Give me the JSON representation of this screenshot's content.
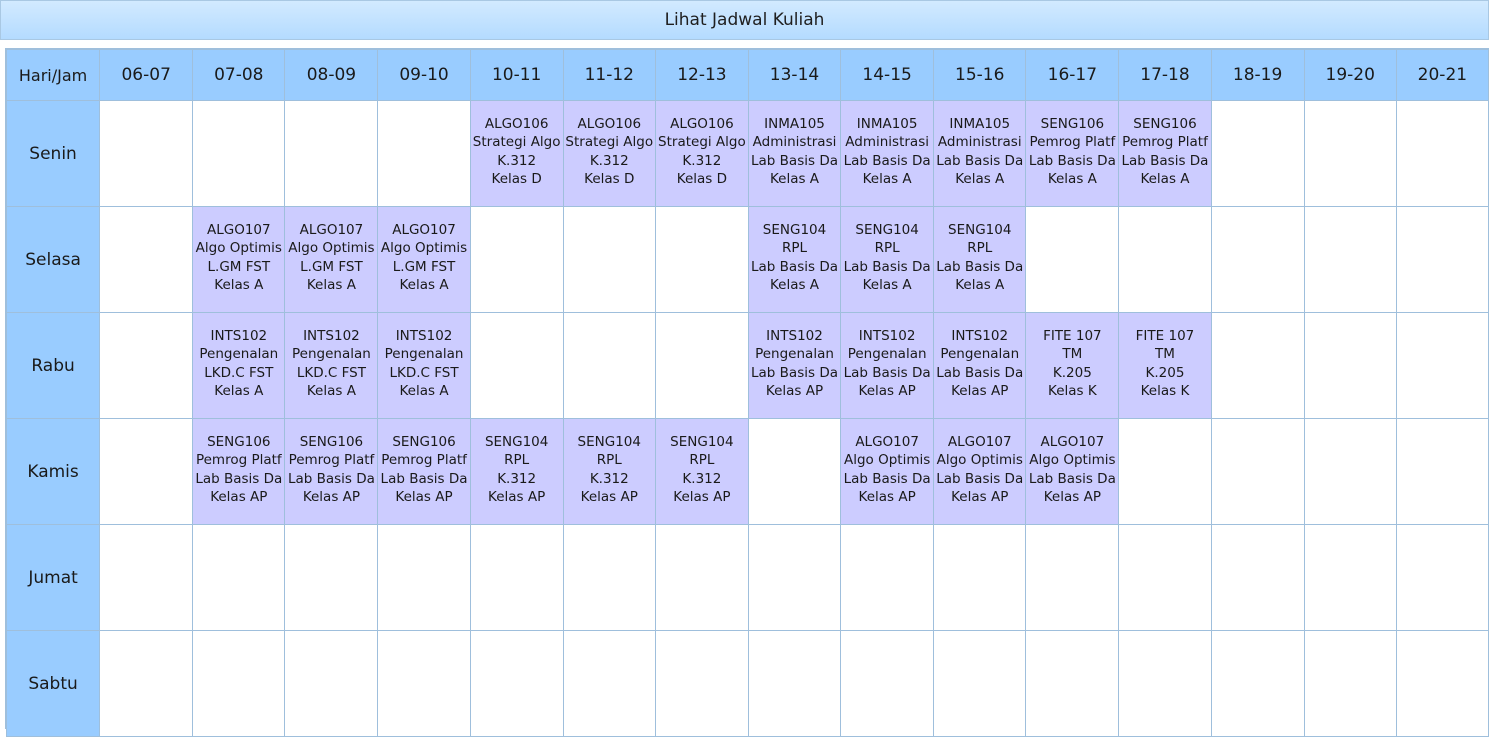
{
  "window": {
    "title": "Lihat Jadwal Kuliah"
  },
  "schedule": {
    "corner_label": "Hari/Jam",
    "hours": [
      "06-07",
      "07-08",
      "08-09",
      "09-10",
      "10-11",
      "11-12",
      "12-13",
      "13-14",
      "14-15",
      "15-16",
      "16-17",
      "17-18",
      "18-19",
      "19-20",
      "20-21"
    ],
    "days": [
      {
        "name": "Senin",
        "slots": [
          null,
          null,
          null,
          null,
          {
            "code": "ALGO106",
            "name": "Strategi Algo",
            "room": "K.312",
            "cls": "Kelas D"
          },
          {
            "code": "ALGO106",
            "name": "Strategi Algo",
            "room": "K.312",
            "cls": "Kelas D"
          },
          {
            "code": "ALGO106",
            "name": "Strategi Algo",
            "room": "K.312",
            "cls": "Kelas D"
          },
          {
            "code": "INMA105",
            "name": "Administrasi",
            "room": "Lab Basis Da",
            "cls": "Kelas A"
          },
          {
            "code": "INMA105",
            "name": "Administrasi",
            "room": "Lab Basis Da",
            "cls": "Kelas A"
          },
          {
            "code": "INMA105",
            "name": "Administrasi",
            "room": "Lab Basis Da",
            "cls": "Kelas A"
          },
          {
            "code": "SENG106",
            "name": "Pemrog Platf",
            "room": "Lab Basis Da",
            "cls": "Kelas A"
          },
          {
            "code": "SENG106",
            "name": "Pemrog Platf",
            "room": "Lab Basis Da",
            "cls": "Kelas A"
          },
          null,
          null,
          null
        ]
      },
      {
        "name": "Selasa",
        "slots": [
          null,
          {
            "code": "ALGO107",
            "name": "Algo Optimis",
            "room": "L.GM FST",
            "cls": "Kelas A"
          },
          {
            "code": "ALGO107",
            "name": "Algo Optimis",
            "room": "L.GM FST",
            "cls": "Kelas A"
          },
          {
            "code": "ALGO107",
            "name": "Algo Optimis",
            "room": "L.GM FST",
            "cls": "Kelas A"
          },
          null,
          null,
          null,
          {
            "code": "SENG104",
            "name": "RPL",
            "room": "Lab Basis Da",
            "cls": "Kelas A"
          },
          {
            "code": "SENG104",
            "name": "RPL",
            "room": "Lab Basis Da",
            "cls": "Kelas A"
          },
          {
            "code": "SENG104",
            "name": "RPL",
            "room": "Lab Basis Da",
            "cls": "Kelas A"
          },
          null,
          null,
          null,
          null,
          null
        ]
      },
      {
        "name": "Rabu",
        "slots": [
          null,
          {
            "code": "INTS102",
            "name": "Pengenalan",
            "room": "LKD.C FST",
            "cls": "Kelas A"
          },
          {
            "code": "INTS102",
            "name": "Pengenalan",
            "room": "LKD.C FST",
            "cls": "Kelas A"
          },
          {
            "code": "INTS102",
            "name": "Pengenalan",
            "room": "LKD.C FST",
            "cls": "Kelas A"
          },
          null,
          null,
          null,
          {
            "code": "INTS102",
            "name": "Pengenalan",
            "room": "Lab Basis Da",
            "cls": "Kelas AP"
          },
          {
            "code": "INTS102",
            "name": "Pengenalan",
            "room": "Lab Basis Da",
            "cls": "Kelas AP"
          },
          {
            "code": "INTS102",
            "name": "Pengenalan",
            "room": "Lab Basis Da",
            "cls": "Kelas AP"
          },
          {
            "code": "FITE 107",
            "name": "TM",
            "room": "K.205",
            "cls": "Kelas K"
          },
          {
            "code": "FITE 107",
            "name": "TM",
            "room": "K.205",
            "cls": "Kelas K"
          },
          null,
          null,
          null
        ]
      },
      {
        "name": "Kamis",
        "slots": [
          null,
          {
            "code": "SENG106",
            "name": "Pemrog Platf",
            "room": "Lab Basis Da",
            "cls": "Kelas AP"
          },
          {
            "code": "SENG106",
            "name": "Pemrog Platf",
            "room": "Lab Basis Da",
            "cls": "Kelas AP"
          },
          {
            "code": "SENG106",
            "name": "Pemrog Platf",
            "room": "Lab Basis Da",
            "cls": "Kelas AP"
          },
          {
            "code": "SENG104",
            "name": "RPL",
            "room": "K.312",
            "cls": "Kelas AP"
          },
          {
            "code": "SENG104",
            "name": "RPL",
            "room": "K.312",
            "cls": "Kelas AP"
          },
          {
            "code": "SENG104",
            "name": "RPL",
            "room": "K.312",
            "cls": "Kelas AP"
          },
          null,
          {
            "code": "ALGO107",
            "name": "Algo Optimis",
            "room": "Lab Basis Da",
            "cls": "Kelas AP"
          },
          {
            "code": "ALGO107",
            "name": "Algo Optimis",
            "room": "Lab Basis Da",
            "cls": "Kelas AP"
          },
          {
            "code": "ALGO107",
            "name": "Algo Optimis",
            "room": "Lab Basis Da",
            "cls": "Kelas AP"
          },
          null,
          null,
          null,
          null
        ]
      },
      {
        "name": "Jumat",
        "slots": [
          null,
          null,
          null,
          null,
          null,
          null,
          null,
          null,
          null,
          null,
          null,
          null,
          null,
          null,
          null
        ]
      },
      {
        "name": "Sabtu",
        "slots": [
          null,
          null,
          null,
          null,
          null,
          null,
          null,
          null,
          null,
          null,
          null,
          null,
          null,
          null,
          null
        ]
      }
    ]
  },
  "colors": {
    "header_bg": "#99ccff",
    "filled_slot_bg": "#ccccff",
    "empty_slot_bg": "#ffffff",
    "grid_line": "#9fbfdc"
  }
}
